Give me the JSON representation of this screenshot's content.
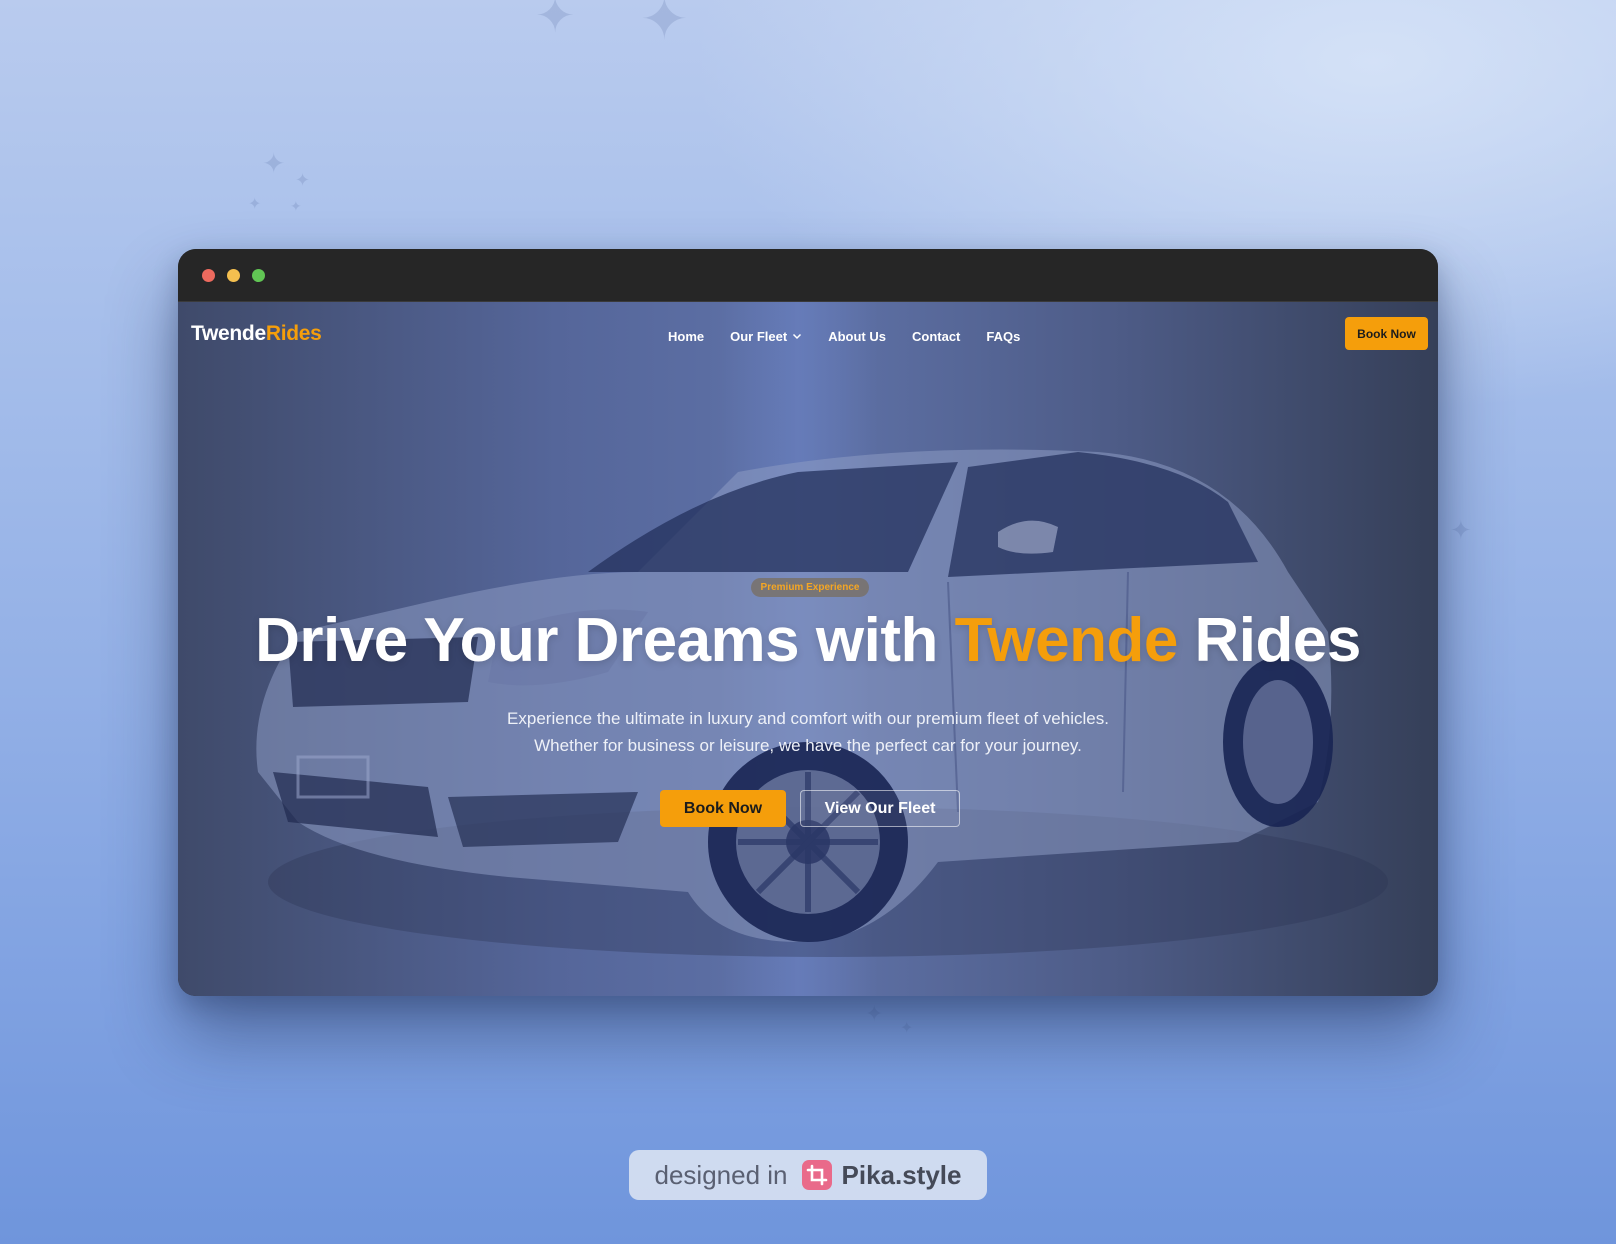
{
  "colors": {
    "accent": "#f59e0b",
    "titlebar": "#262626",
    "hero_overlay": "#55669a",
    "text_light": "#ffffff"
  },
  "window": {
    "controls": [
      "close",
      "minimize",
      "maximize"
    ]
  },
  "nav": {
    "logo_part1": "Twende",
    "logo_part2": "Rides",
    "links": [
      {
        "label": "Home"
      },
      {
        "label": "Our Fleet",
        "icon": "chevron-down-icon"
      },
      {
        "label": "About Us"
      },
      {
        "label": "Contact"
      },
      {
        "label": "FAQs"
      }
    ],
    "cta_label": "Book Now"
  },
  "hero": {
    "badge": "Premium Experience",
    "headline_part1": "Drive Your Dreams with ",
    "headline_highlight": "Twende",
    "headline_part2": " Rides",
    "subtext_line1": "Experience the ultimate in luxury and comfort with our premium fleet of vehicles.",
    "subtext_line2": "Whether for business or leisure, we have the perfect car for your journey.",
    "primary_button": "Book Now",
    "secondary_button": "View Our Fleet",
    "background_image": "car-image"
  },
  "watermark": {
    "text": "designed in",
    "brand": "Pika.style",
    "icon": "crop-icon"
  }
}
